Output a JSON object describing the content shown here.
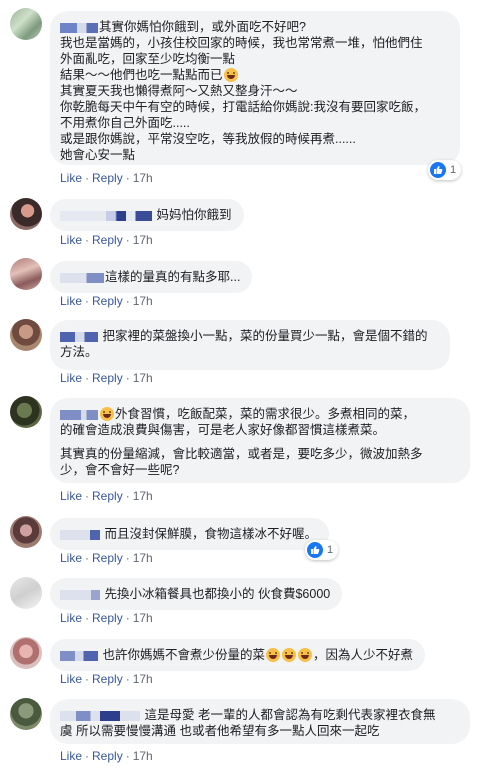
{
  "actions": {
    "like": "Like",
    "reply": "Reply",
    "sep": "·"
  },
  "comments": [
    {
      "lines": [
        "其實你媽怕你餓到，或外面吃不好吧?",
        "我也是當媽的，小孩住校回家的時候，我也常常煮一堆，怕他們住",
        "外面亂吃，回家至少吃均衡一點",
        "結果～～他們也吃一點點而已",
        "其實夏天我也懶得煮阿～又熱又整身汗～～",
        "你乾脆每天中午有空的時候，打電話給你媽說:我沒有要回家吃飯，",
        "不用煮你自己外面吃.....",
        "或是跟你媽說，平常沒空吃，等我放假的時候再煮......",
        "她會心安一點"
      ],
      "time": "17h",
      "reactions": "1"
    },
    {
      "lines": [
        "妈妈怕你餓到"
      ],
      "time": "17h"
    },
    {
      "lines": [
        "這樣的量真的有點多耶..."
      ],
      "time": "17h"
    },
    {
      "lines": [
        "把家裡的菜盤換小一點，菜的份量買少一點，會是個不錯的",
        "方法。"
      ],
      "time": "17h"
    },
    {
      "lines": [
        "外食習慣，吃飯配菜，菜的需求很少。多煮相同的菜，",
        "的確會造成浪費與傷害，可是老人家好像都習慣這樣煮菜。",
        "",
        "其實真的份量縮減，會比較適當，或者是，要吃多少，微波加熱多",
        "少，會不會好一些呢?"
      ],
      "time": "17h"
    },
    {
      "lines": [
        "而且沒封保鮮膜，食物這樣冰不好喔。"
      ],
      "time": "17h",
      "reactions": "1"
    },
    {
      "lines": [
        "先換小冰箱餐具也都換小的 伙食費$6000"
      ],
      "time": "17h"
    },
    {
      "lines": [
        "也許你媽媽不會煮少份量的菜",
        "，因為人少不好煮"
      ],
      "time": "17h"
    },
    {
      "lines": [
        "這是母愛 老一輩的人都會認為有吃剩代表家裡衣食無",
        "虞 所以需要慢慢溝通 也或者他希望有多一點人回來一起吃"
      ],
      "time": "17h"
    }
  ],
  "colors": {
    "link": "#385898",
    "bubble": "#f2f3f5",
    "like_blue": "#1877f2",
    "blur": "#7f8ec4"
  }
}
